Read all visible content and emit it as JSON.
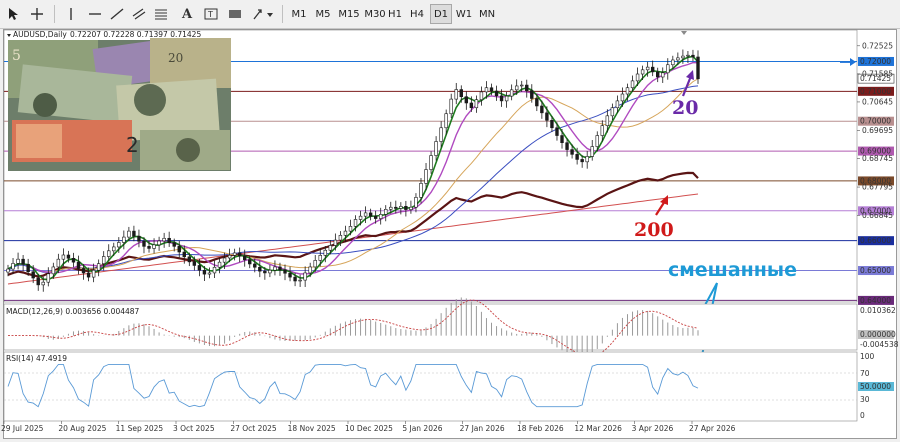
{
  "toolbar": {
    "timeframes": [
      "M1",
      "M5",
      "M15",
      "M30",
      "H1",
      "H4",
      "D1",
      "W1",
      "MN"
    ],
    "selected_timeframe": "D1"
  },
  "chart_data": {
    "type": "candlestick",
    "symbol": "AUDUSD,Daily",
    "ohlc_header": "0.72207 0.72228 0.71397 0.71425",
    "x_labels": [
      "29 Jul 2025",
      "20 Aug 2025",
      "11 Sep 2025",
      "3 Oct 2025",
      "27 Oct 2025",
      "18 Nov 2025",
      "10 Dec 2025",
      "5 Jan 2026",
      "27 Jan 2026",
      "18 Feb 2026",
      "12 Mar 2026",
      "3 Apr 2026",
      "27 Apr 2026"
    ],
    "price_range": [
      0.6398,
      0.7302
    ],
    "price_labels": [
      "0.72525",
      "0.71585",
      "0.70645",
      "0.69695",
      "0.68745",
      "0.67795",
      "0.66845"
    ],
    "horizontal_levels": [
      {
        "label": "0.72000",
        "value": 0.72,
        "color": "#1e73d8"
      },
      {
        "label": "0.71000",
        "value": 0.71,
        "color": "#7b1c1c"
      },
      {
        "label": "0.70000",
        "value": 0.7,
        "color": "#b88f8f"
      },
      {
        "label": "0.69000",
        "value": 0.69,
        "color": "#b05ab0"
      },
      {
        "label": "0.68000",
        "value": 0.68,
        "color": "#7b4a2a"
      },
      {
        "label": "0.67000",
        "value": 0.67,
        "color": "#b57fd6"
      },
      {
        "label": "0.66000",
        "value": 0.66,
        "color": "#1a2e9e"
      },
      {
        "label": "0.65000",
        "value": 0.65,
        "color": "#7a7ad6"
      },
      {
        "label": "0.64000",
        "value": 0.64,
        "color": "#6a2a7a"
      }
    ],
    "current_price_label": "0.71425",
    "current_price": 0.71425,
    "close_series": [
      0.6505,
      0.6524,
      0.6538,
      0.6521,
      0.6496,
      0.6475,
      0.6452,
      0.6461,
      0.6489,
      0.6512,
      0.6538,
      0.6552,
      0.6541,
      0.6528,
      0.6507,
      0.6492,
      0.6478,
      0.6501,
      0.6523,
      0.6547,
      0.6566,
      0.6579,
      0.6594,
      0.6612,
      0.6632,
      0.6615,
      0.6598,
      0.6581,
      0.6574,
      0.6586,
      0.6599,
      0.6608,
      0.6593,
      0.6581,
      0.6562,
      0.6546,
      0.6529,
      0.6517,
      0.6501,
      0.6488,
      0.6492,
      0.6511,
      0.6528,
      0.6542,
      0.6551,
      0.6559,
      0.6548,
      0.6536,
      0.6522,
      0.6511,
      0.6498,
      0.6492,
      0.6501,
      0.6512,
      0.6502,
      0.6491,
      0.6478,
      0.6465,
      0.6468,
      0.6492,
      0.6512,
      0.6534,
      0.6551,
      0.6568,
      0.6584,
      0.6602,
      0.6618,
      0.6632,
      0.6648,
      0.6671,
      0.6682,
      0.6693,
      0.6682,
      0.6674,
      0.6688,
      0.6705,
      0.6712,
      0.6708,
      0.6715,
      0.6704,
      0.6712,
      0.6745,
      0.6792,
      0.6838,
      0.6885,
      0.6932,
      0.6978,
      0.7025,
      0.7074,
      0.7106,
      0.7082,
      0.7061,
      0.7045,
      0.7072,
      0.7098,
      0.7112,
      0.7101,
      0.7085,
      0.7068,
      0.7084,
      0.7105,
      0.7118,
      0.7121,
      0.7102,
      0.7076,
      0.7051,
      0.7028,
      0.7003,
      0.6978,
      0.6952,
      0.6928,
      0.6905,
      0.6889,
      0.6872,
      0.6864,
      0.6882,
      0.6915,
      0.6952,
      0.6985,
      0.7018,
      0.7045,
      0.7068,
      0.7091,
      0.7112,
      0.7135,
      0.7158,
      0.7172,
      0.7181,
      0.7165,
      0.7148,
      0.7162,
      0.7189,
      0.7205,
      0.7212,
      0.7218,
      0.7221,
      0.7215,
      0.7142
    ]
  },
  "annotations": {
    "ma20": "20",
    "ma200": "200",
    "mixed_label": "смешанные"
  },
  "macd": {
    "label": "MACD(12,26,9) 0.003656 0.004487",
    "scale_top": "0.010362",
    "scale_zero": "0.000000",
    "scale_bottom": "-0.004538"
  },
  "rsi": {
    "label": "RSI(14) 47.4919",
    "scale_100": "100",
    "scale_70": "70",
    "scale_50": "50.0000",
    "scale_30": "30",
    "scale_0": "0",
    "value": 47.4919
  },
  "colors": {
    "bull": "#1a1a1a",
    "ma_green": "#1d7a1d",
    "ma_violet": "#b04ac0",
    "ma_orange": "#d6a55a",
    "ma_blue": "#3a4ec0",
    "ma_maroon": "#5a1414",
    "ma_red": "#d25050",
    "rsi_line": "#5a9ad6",
    "macd_signal": "#c84040",
    "annot_purple": "#6a2aa8",
    "annot_red": "#d01a1a",
    "annot_blue": "#1e9ad6"
  }
}
